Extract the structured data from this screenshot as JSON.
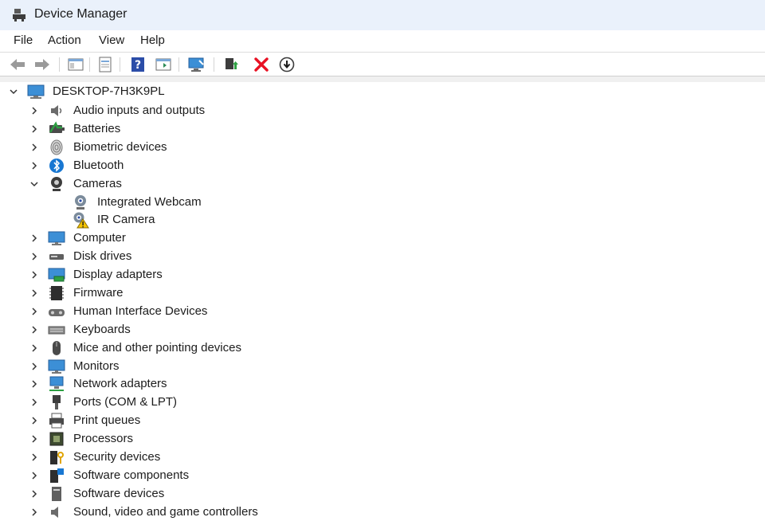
{
  "window": {
    "title": "Device Manager",
    "app_icon": "device-manager-icon"
  },
  "menu": {
    "items": [
      "File",
      "Action",
      "View",
      "Help"
    ]
  },
  "toolbar": {
    "buttons": [
      "back-arrow-icon",
      "forward-arrow-icon",
      "show-hide-console-tree-icon",
      "properties-icon",
      "help-icon",
      "action-pane-icon",
      "scan-hardware-icon",
      "update-driver-icon",
      "uninstall-device-icon",
      "disable-device-icon"
    ]
  },
  "tree": {
    "root": {
      "label": "DESKTOP-7H3K9PL",
      "icon": "computer-icon",
      "expanded": true
    },
    "categories": [
      {
        "label": "Audio inputs and outputs",
        "icon": "speaker-icon"
      },
      {
        "label": "Batteries",
        "icon": "battery-icon"
      },
      {
        "label": "Biometric devices",
        "icon": "fingerprint-icon"
      },
      {
        "label": "Bluetooth",
        "icon": "bluetooth-icon"
      },
      {
        "label": "Cameras",
        "icon": "camera-icon",
        "expanded": true,
        "children": [
          {
            "label": "Integrated Webcam",
            "icon": "webcam-icon"
          },
          {
            "label": "IR Camera",
            "icon": "webcam-warning-icon"
          }
        ]
      },
      {
        "label": "Computer",
        "icon": "monitor-icon"
      },
      {
        "label": "Disk drives",
        "icon": "disk-drive-icon"
      },
      {
        "label": "Display adapters",
        "icon": "display-adapter-icon"
      },
      {
        "label": "Firmware",
        "icon": "firmware-icon"
      },
      {
        "label": "Human Interface Devices",
        "icon": "hid-icon"
      },
      {
        "label": "Keyboards",
        "icon": "keyboard-icon"
      },
      {
        "label": "Mice and other pointing devices",
        "icon": "mouse-icon"
      },
      {
        "label": "Monitors",
        "icon": "monitor-icon"
      },
      {
        "label": "Network adapters",
        "icon": "network-adapter-icon"
      },
      {
        "label": "Ports (COM & LPT)",
        "icon": "port-icon"
      },
      {
        "label": "Print queues",
        "icon": "printer-icon"
      },
      {
        "label": "Processors",
        "icon": "processor-icon"
      },
      {
        "label": "Security devices",
        "icon": "security-device-icon"
      },
      {
        "label": "Software components",
        "icon": "software-component-icon"
      },
      {
        "label": "Software devices",
        "icon": "software-device-icon"
      },
      {
        "label": "Sound, video and game controllers",
        "icon": "sound-controller-icon"
      }
    ]
  },
  "colors": {
    "titlebar": "#eaf1fb",
    "accent": "#0078d4",
    "warning": "#f5c400",
    "delete_red": "#e81123"
  }
}
